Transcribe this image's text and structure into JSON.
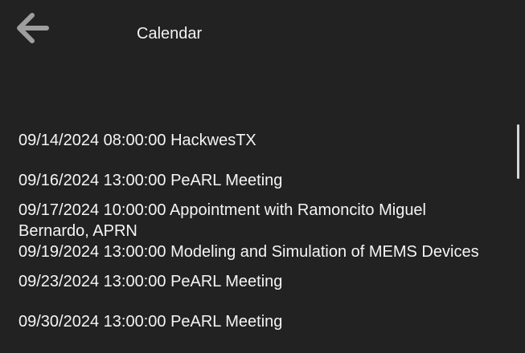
{
  "header": {
    "back_icon": "arrow-left-icon",
    "title": "Calendar"
  },
  "colors": {
    "background": "#222222",
    "text": "#f5f5f5",
    "back_icon": "#9e9e9e",
    "scrollbar": "#d6d6d6"
  },
  "events": [
    {
      "text": "09/14/2024 08:00:00 HackwesTX"
    },
    {
      "text": "09/16/2024 13:00:00 PeARL Meeting"
    },
    {
      "text": "09/17/2024 10:00:00 Appointment with Ramoncito Miguel Bernardo, APRN"
    },
    {
      "text": "09/19/2024 13:00:00 Modeling and Simulation of MEMS Devices"
    },
    {
      "text": "09/23/2024 13:00:00 PeARL Meeting"
    },
    {
      "text": "09/30/2024 13:00:00 PeARL Meeting"
    }
  ]
}
